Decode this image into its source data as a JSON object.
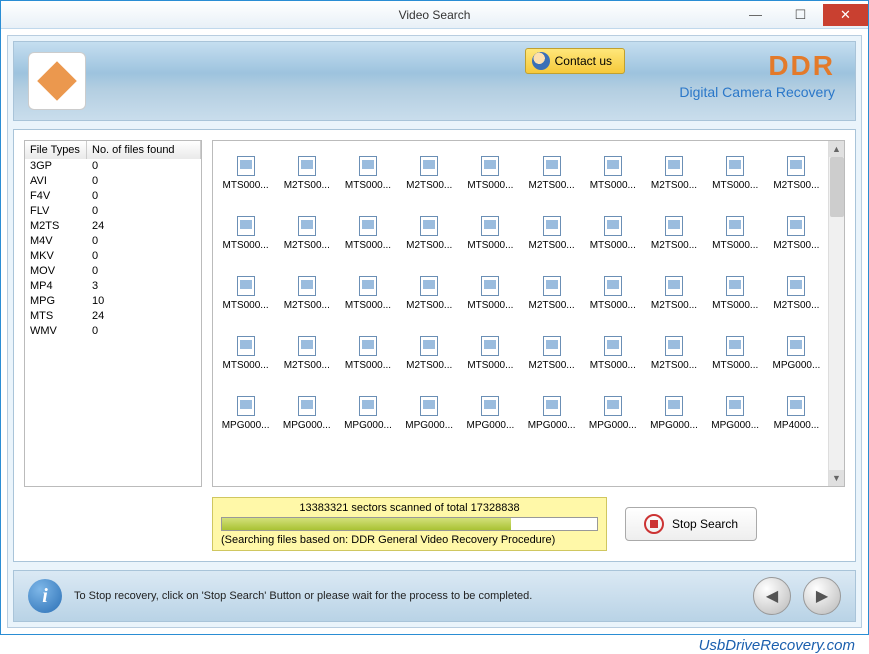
{
  "window": {
    "title": "Video Search"
  },
  "banner": {
    "contact_label": "Contact us",
    "brand_main": "DDR",
    "brand_sub": "Digital Camera Recovery"
  },
  "file_types": {
    "col1": "File Types",
    "col2": "No. of files found",
    "rows": [
      {
        "type": "3GP",
        "count": "0"
      },
      {
        "type": "AVI",
        "count": "0"
      },
      {
        "type": "F4V",
        "count": "0"
      },
      {
        "type": "FLV",
        "count": "0"
      },
      {
        "type": "M2TS",
        "count": "24"
      },
      {
        "type": "M4V",
        "count": "0"
      },
      {
        "type": "MKV",
        "count": "0"
      },
      {
        "type": "MOV",
        "count": "0"
      },
      {
        "type": "MP4",
        "count": "3"
      },
      {
        "type": "MPG",
        "count": "10"
      },
      {
        "type": "MTS",
        "count": "24"
      },
      {
        "type": "WMV",
        "count": "0"
      }
    ]
  },
  "file_grid": {
    "items": [
      "MTS000...",
      "M2TS00...",
      "MTS000...",
      "M2TS00...",
      "MTS000...",
      "M2TS00...",
      "MTS000...",
      "M2TS00...",
      "MTS000...",
      "M2TS00...",
      "MTS000...",
      "M2TS00...",
      "MTS000...",
      "M2TS00...",
      "MTS000...",
      "M2TS00...",
      "MTS000...",
      "M2TS00...",
      "MTS000...",
      "M2TS00...",
      "MTS000...",
      "M2TS00...",
      "MTS000...",
      "M2TS00...",
      "MTS000...",
      "M2TS00...",
      "MTS000...",
      "M2TS00...",
      "MTS000...",
      "M2TS00...",
      "MTS000...",
      "M2TS00...",
      "MTS000...",
      "M2TS00...",
      "MTS000...",
      "M2TS00...",
      "MTS000...",
      "M2TS00...",
      "MTS000...",
      "MPG000...",
      "MPG000...",
      "MPG000...",
      "MPG000...",
      "MPG000...",
      "MPG000...",
      "MPG000...",
      "MPG000...",
      "MPG000...",
      "MPG000...",
      "MP4000..."
    ]
  },
  "status": {
    "sectors": "13383321 sectors scanned of total 17328838",
    "procedure": "(Searching files based on:  DDR General Video Recovery Procedure)",
    "stop_label": "Stop Search"
  },
  "footer": {
    "text": "To Stop recovery, click on 'Stop Search' Button or please wait for the process to be completed."
  },
  "watermark": "UsbDriveRecovery.com"
}
